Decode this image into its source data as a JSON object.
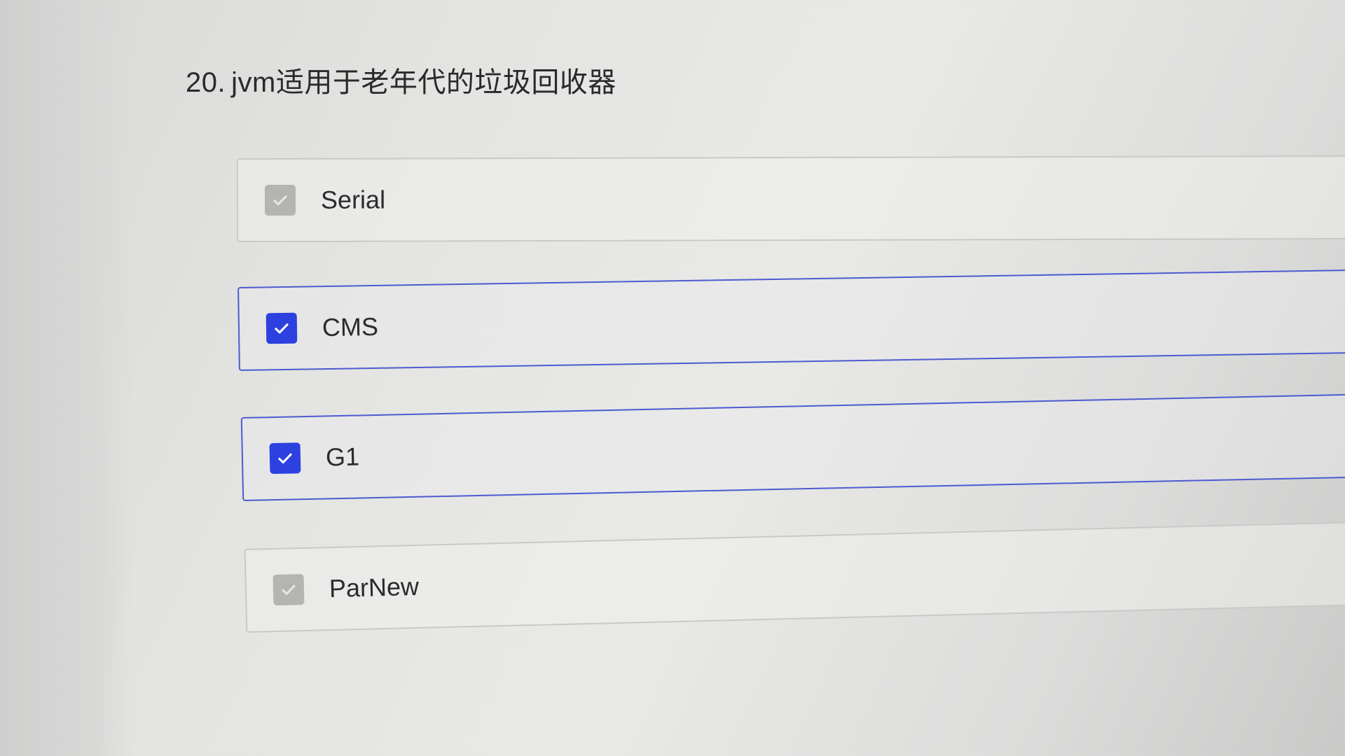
{
  "question": {
    "number": "20.",
    "text": "jvm适用于老年代的垃圾回收器"
  },
  "options": [
    {
      "label": "Serial",
      "checked": false
    },
    {
      "label": "CMS",
      "checked": true
    },
    {
      "label": "G1",
      "checked": true
    },
    {
      "label": "ParNew",
      "checked": false
    }
  ],
  "colors": {
    "checked_box": "#2d41e0",
    "unchecked_box": "#b4b4b2",
    "checked_border": "#4b5bd0",
    "unchecked_border": "#c9c9c7"
  },
  "icons": {
    "checkbox_mark": "check-icon"
  }
}
